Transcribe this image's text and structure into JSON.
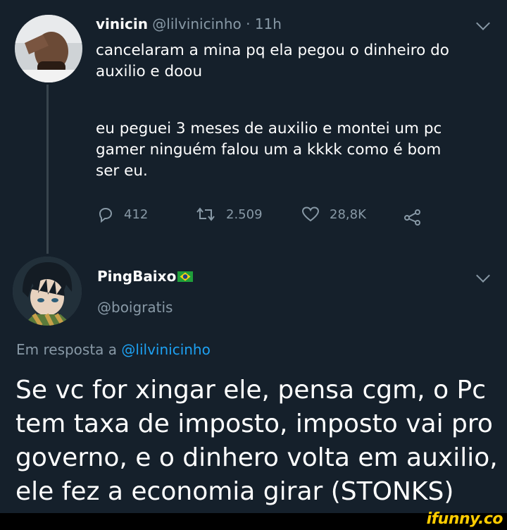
{
  "tweet1": {
    "name": "vinicin",
    "handle": "@lilvinicinho",
    "separator": " · ",
    "time": "11h",
    "lines": [
      "cancelaram a mina pq ela pegou o dinheiro do",
      "auxilio e doou",
      "eu peguei 3 meses de auxilio e montei um pc",
      "gamer ninguém falou um a kkkk como é bom",
      "ser eu."
    ],
    "reply_count": "412",
    "retweet_count": "2.509",
    "like_count": "28,8K"
  },
  "tweet2": {
    "name": "PingBaixo",
    "handle": "@boigratis",
    "reply_prefix": "Em resposta a ",
    "reply_to": "@lilvinicinho",
    "lines": [
      "Se vc for xingar ele, pensa cgm, o Pc",
      "tem taxa de imposto, imposto vai pro",
      "governo, e o dinhero volta em auxilio,",
      "ele fez a economia girar (STONKS)"
    ]
  },
  "watermark": "ifunny.co",
  "colors": {
    "background": "#15202b",
    "muted": "#8899a6",
    "link": "#1da1f2",
    "watermark": "#ffcc00"
  }
}
